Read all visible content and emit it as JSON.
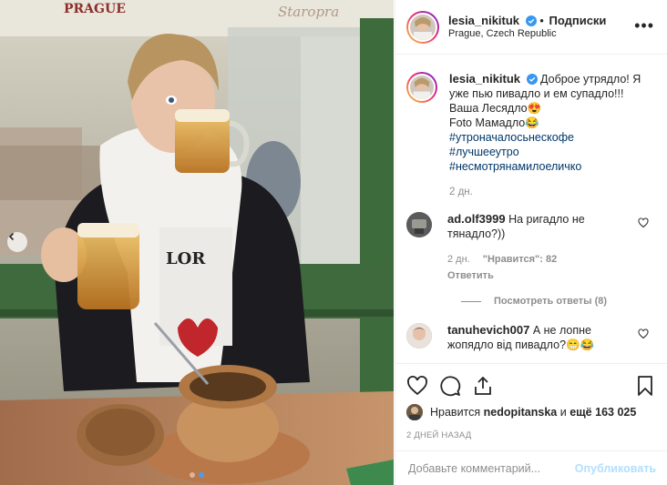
{
  "post": {
    "username": "lesia_nikituk",
    "separator": "•",
    "follow_label": "Подписки",
    "location": "Prague, Czech Republic",
    "more_label": "•••"
  },
  "caption": {
    "username": "lesia_nikituk",
    "text": "Доброе утрядло! Я уже пью пивадло и ем супадло!!! Ваша Лесядло😍",
    "line2": "Foto Мамадло😂",
    "hashtags": [
      "#утроначалосьнескофе",
      "#лучшееутро",
      "#несмотрянамилоеличко"
    ],
    "time": "2 дн."
  },
  "comments": [
    {
      "username": "ad.olf3999",
      "text": "На ригадло не тянадло?))",
      "time": "2 дн.",
      "likes_label": "\"Нравится\": 82",
      "reply_label": "Ответить",
      "view_replies_label": "Посмотреть ответы (8)"
    },
    {
      "username": "tanuhevich007",
      "text": "А не лопне жопядло від пивадло?😁😂"
    }
  ],
  "photo": {
    "signage": [
      "PRAGUE",
      "Staropra"
    ]
  },
  "likes": {
    "prefix": "Нравится",
    "user": "nedopitanska",
    "middle": "и",
    "count_label": "ещё 163 025"
  },
  "timestamp": "2 ДНЕЙ НАЗАД",
  "comment_box": {
    "placeholder": "Добавьте комментарий...",
    "publish_label": "Опубликовать"
  },
  "colors": {
    "verified": "#3897f0",
    "link": "#00376b",
    "muted": "#8e8e8e",
    "publish_disabled": "#b2dffc",
    "carousel_dot_active": "#4c9bf0"
  },
  "icons": [
    "verified-badge-icon",
    "heart-icon",
    "comment-icon",
    "share-icon",
    "bookmark-icon",
    "chevron-left-icon",
    "more-options-icon"
  ],
  "carousel": {
    "current": 2,
    "total": 2
  }
}
